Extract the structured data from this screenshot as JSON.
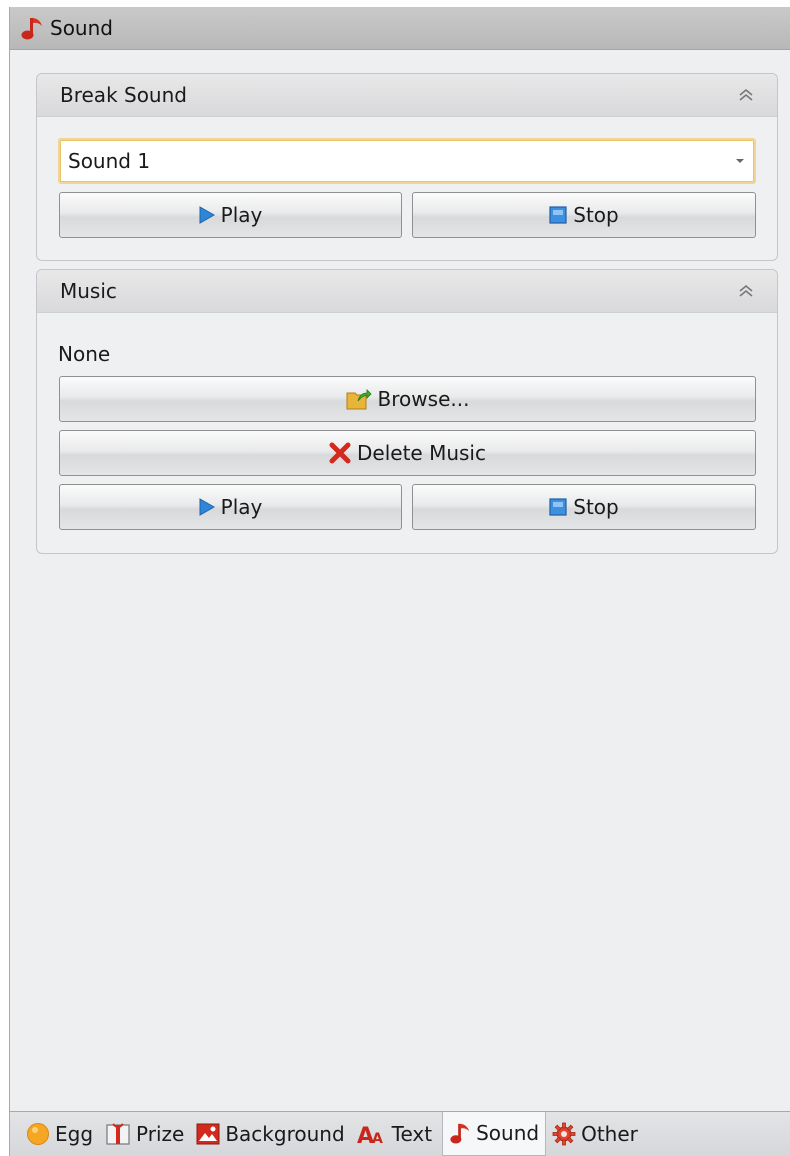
{
  "panel": {
    "title": "Sound",
    "title_icon": "music-note-icon"
  },
  "break_sound": {
    "title": "Break Sound",
    "selected_sound": "Sound 1",
    "play_label": "Play",
    "stop_label": "Stop"
  },
  "music": {
    "title": "Music",
    "current_file": "None",
    "browse_label": "Browse...",
    "delete_label": "Delete Music",
    "play_label": "Play",
    "stop_label": "Stop"
  },
  "tabs": [
    {
      "label": "Egg",
      "icon": "egg-icon"
    },
    {
      "label": "Prize",
      "icon": "prize-icon"
    },
    {
      "label": "Background",
      "icon": "background-image-icon"
    },
    {
      "label": "Text",
      "icon": "text-icon"
    },
    {
      "label": "Sound",
      "icon": "music-note-icon",
      "active": true
    },
    {
      "label": "Other",
      "icon": "gear-icon"
    }
  ],
  "colors": {
    "accent_red": "#d42a1e",
    "play_blue": "#2f86d8",
    "combo_focus": "#f2d594"
  }
}
